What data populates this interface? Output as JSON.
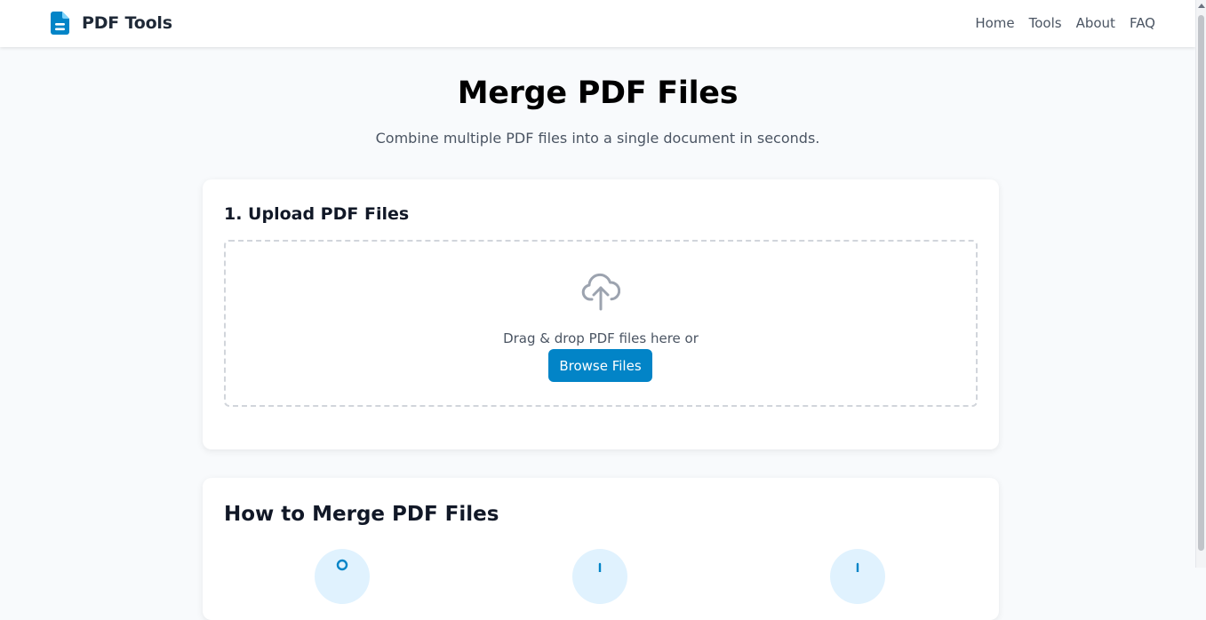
{
  "header": {
    "brand_name": "PDF Tools",
    "nav": [
      {
        "label": "Home"
      },
      {
        "label": "Tools"
      },
      {
        "label": "About"
      },
      {
        "label": "FAQ"
      }
    ]
  },
  "hero": {
    "title": "Merge PDF Files",
    "subtitle": "Combine multiple PDF files into a single document in seconds."
  },
  "upload": {
    "title": "1. Upload PDF Files",
    "drop_text": "Drag & drop PDF files here or",
    "browse_label": "Browse Files"
  },
  "howto": {
    "title": "How to Merge PDF Files",
    "steps": [
      {
        "icon": "upload-step-icon"
      },
      {
        "icon": "arrange-step-icon"
      },
      {
        "icon": "download-step-icon"
      }
    ]
  },
  "colors": {
    "accent": "#0284c7",
    "brand_icon": "#0284c7",
    "step_circle": "#e0f2fe",
    "page_bg": "#f8fafc"
  },
  "icons": {
    "brand": "document-icon",
    "upload": "cloud-upload-icon"
  }
}
